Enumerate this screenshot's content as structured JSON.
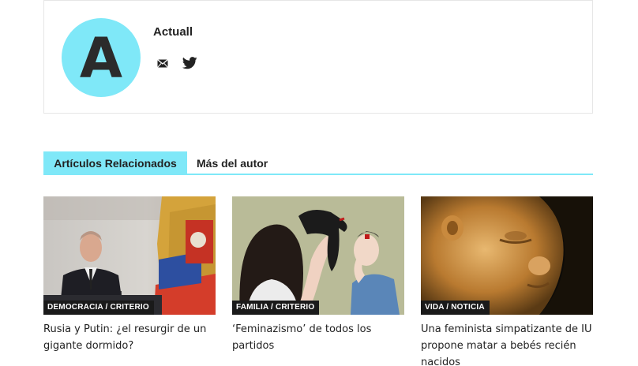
{
  "author": {
    "avatar_letter": "A",
    "name": "Actuall",
    "social": [
      {
        "icon": "envelope-icon"
      },
      {
        "icon": "twitter-icon"
      }
    ]
  },
  "tabs": {
    "related": "Artículos Relacionados",
    "more": "Más del autor"
  },
  "articles": [
    {
      "category": "DEMOCRACIA / CRITERIO",
      "title": "Rusia y Putin: ¿el resurgir de un gigante dormido?"
    },
    {
      "category": "FAMILIA / CRITERIO",
      "title": "‘Feminazismo’ de todos los partidos"
    },
    {
      "category": "VIDA / NOTICIA",
      "title": "Una feminista simpatizante de IU propone matar a bebés recién nacidos"
    }
  ],
  "colors": {
    "accent": "#7fe8f8",
    "badge_bg": "#1a1a1a",
    "border": "#e6e6e6"
  }
}
